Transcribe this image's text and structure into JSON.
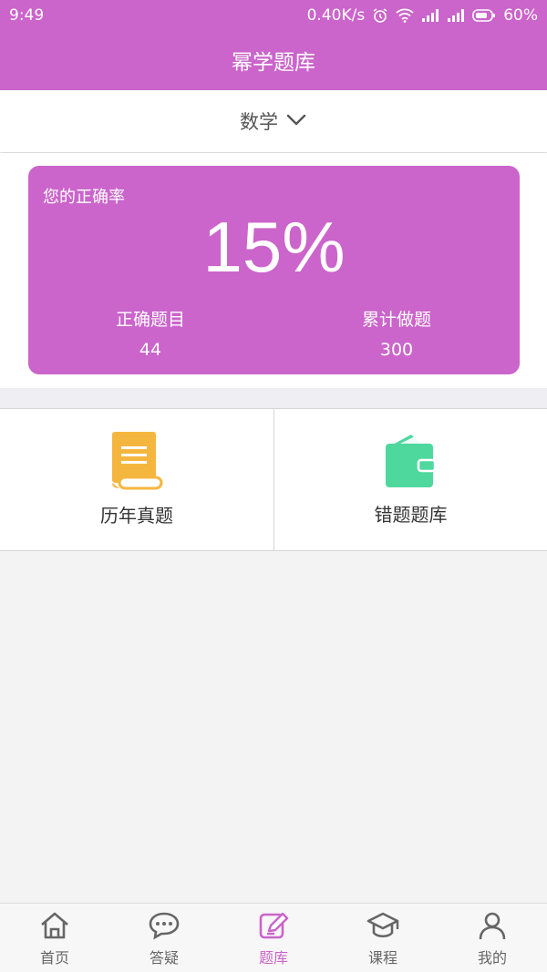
{
  "status_bar": {
    "time": "9:49",
    "network_speed": "0.40K/s",
    "battery": "60%",
    "icons": [
      "alarm-icon",
      "wifi-icon",
      "signal-icon",
      "signal-icon",
      "battery-icon"
    ]
  },
  "header": {
    "title": "幂学题库"
  },
  "subject_selector": {
    "label": "数学",
    "icon": "chevron-down-icon"
  },
  "stats": {
    "title": "您的正确率",
    "accuracy": "15%",
    "correct_label": "正确题目",
    "correct_count": "44",
    "total_label": "累计做题",
    "total_count": "300"
  },
  "menu": [
    {
      "label": "历年真题",
      "icon": "scroll-icon",
      "color": "#f5b640"
    },
    {
      "label": "错题题库",
      "icon": "wallet-icon",
      "color": "#4fd89e"
    }
  ],
  "tabs": [
    {
      "label": "首页",
      "icon": "home-icon",
      "active": false
    },
    {
      "label": "答疑",
      "icon": "chat-icon",
      "active": false
    },
    {
      "label": "题库",
      "icon": "edit-icon",
      "active": true
    },
    {
      "label": "课程",
      "icon": "graduation-cap-icon",
      "active": false
    },
    {
      "label": "我的",
      "icon": "user-icon",
      "active": false
    }
  ],
  "colors": {
    "brand": "#cb64cb",
    "active_tab": "#cb64cb",
    "inactive_tab": "#666666"
  }
}
